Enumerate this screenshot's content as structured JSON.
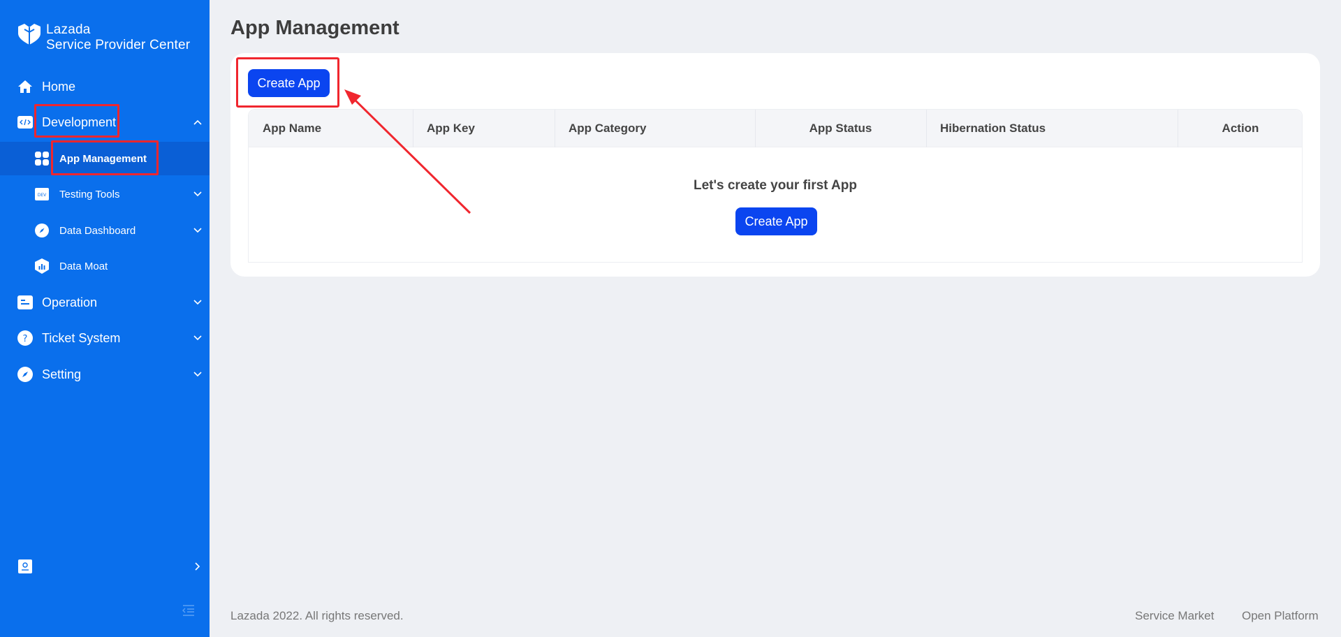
{
  "brand": {
    "line1": "Lazada",
    "line2": "Service Provider Center"
  },
  "sidebar": {
    "items": [
      {
        "label": "Home",
        "icon": "home-icon"
      },
      {
        "label": "Development",
        "icon": "code-icon",
        "expanded": true
      },
      {
        "label": "App Management",
        "icon": "apps-grid-icon",
        "active": true
      },
      {
        "label": "Testing Tools",
        "icon": "dev-icon"
      },
      {
        "label": "Data Dashboard",
        "icon": "compass-icon"
      },
      {
        "label": "Data Moat",
        "icon": "shield-chart-icon"
      },
      {
        "label": "Operation",
        "icon": "document-icon"
      },
      {
        "label": "Ticket System",
        "icon": "question-icon"
      },
      {
        "label": "Setting",
        "icon": "compass-icon"
      }
    ]
  },
  "page": {
    "title": "App Management",
    "create_button": "Create App"
  },
  "table": {
    "columns": [
      "App Name",
      "App Key",
      "App Category",
      "App Status",
      "Hibernation Status",
      "Action"
    ],
    "empty_message": "Let's create your first App",
    "empty_button": "Create App"
  },
  "footer": {
    "copyright": "Lazada 2022. All rights reserved.",
    "links": [
      "Service Market",
      "Open Platform"
    ]
  },
  "colors": {
    "sidebar": "#0a6fec",
    "primary_button": "#0b45f0",
    "annotation": "#f0262e"
  }
}
